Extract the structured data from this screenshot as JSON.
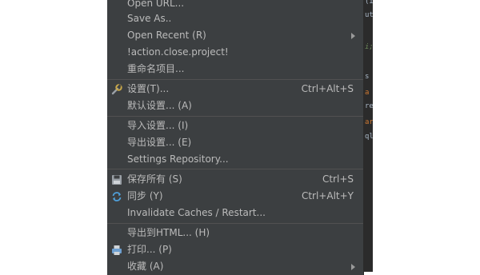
{
  "editor": {
    "fragments": [
      "(I",
      "ut",
      "i;",
      "s",
      "a",
      "re",
      "ar",
      "ql"
    ]
  },
  "menu": {
    "items": [
      {
        "label": "Open URL..."
      },
      {
        "label": "Save As.."
      },
      {
        "label": "Open Recent (R)"
      },
      {
        "label": "!action.close.project!"
      },
      {
        "label": "重命名项目..."
      },
      {
        "label": "设置(T)...",
        "shortcut": "Ctrl+Alt+S",
        "icon": "wrench-icon"
      },
      {
        "label": "默认设置... (A)"
      },
      {
        "label": "导入设置... (I)"
      },
      {
        "label": "导出设置... (E)"
      },
      {
        "label": "Settings Repository..."
      },
      {
        "label": "保存所有 (S)",
        "shortcut": "Ctrl+S",
        "icon": "save-disk-icon"
      },
      {
        "label": "同步 (Y)",
        "shortcut": "Ctrl+Alt+Y",
        "icon": "sync-icon"
      },
      {
        "label": "Invalidate Caches / Restart..."
      },
      {
        "label": "导出到HTML... (H)"
      },
      {
        "label": "打印... (P)",
        "icon": "printer-icon"
      },
      {
        "label": "收藏 (A)"
      }
    ]
  }
}
